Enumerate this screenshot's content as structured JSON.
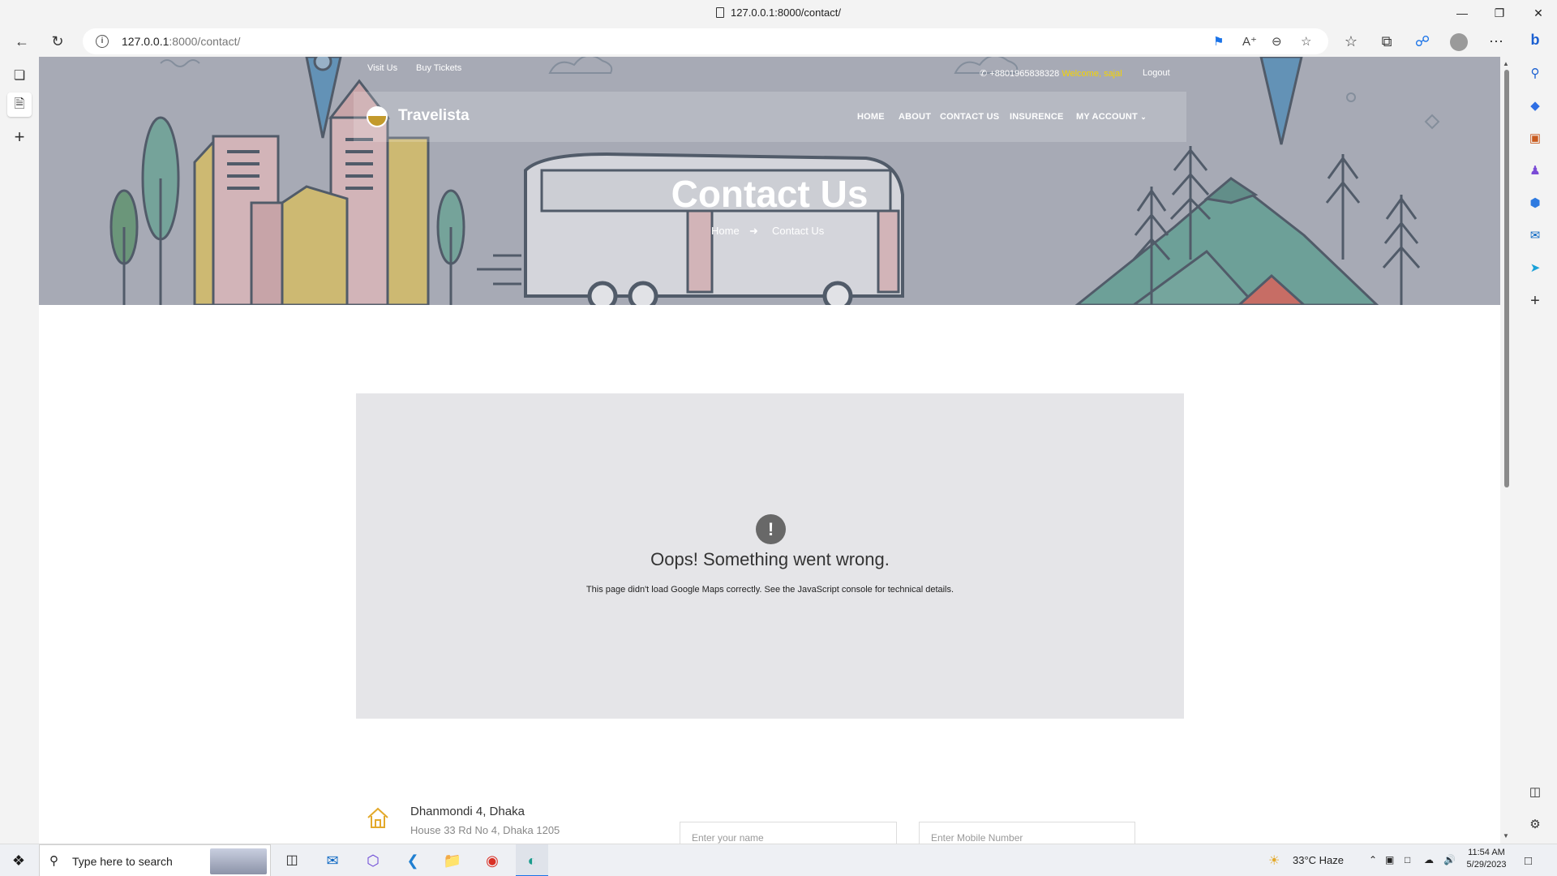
{
  "window": {
    "title": "127.0.0.1:8000/contact/"
  },
  "address_bar": {
    "url_host": "127.0.0.1",
    "url_rest": ":8000/contact/"
  },
  "topbar": {
    "visit_us": "Visit Us",
    "buy_tickets": "Buy Tickets",
    "phone": "+8801965838328",
    "welcome": "Welcome, sajal",
    "logout": "Logout"
  },
  "nav": {
    "brand": "Travelista",
    "items": [
      "HOME",
      "ABOUT",
      "CONTACT US",
      "INSURENCE",
      "MY ACCOUNT"
    ]
  },
  "hero": {
    "title": "Contact Us",
    "breadcrumb_home": "Home",
    "breadcrumb_current": "Contact Us"
  },
  "map_error": {
    "icon": "!",
    "heading": "Oops! Something went wrong.",
    "detail": "This page didn't load Google Maps correctly. See the JavaScript console for technical details."
  },
  "contact": {
    "address_title": "Dhanmondi 4, Dhaka",
    "address_sub": "House 33 Rd No 4, Dhaka 1205",
    "name_placeholder": "Enter your name",
    "mobile_placeholder": "Enter Mobile Number"
  },
  "taskbar": {
    "search_placeholder": "Type here to search",
    "weather": "33°C  Haze",
    "time": "11:54 AM",
    "date": "5/29/2023"
  },
  "colors": {
    "hero_bg": "#a6a9b4",
    "accent_yellow": "#f5d400",
    "map_bg": "#e5e5e8"
  }
}
